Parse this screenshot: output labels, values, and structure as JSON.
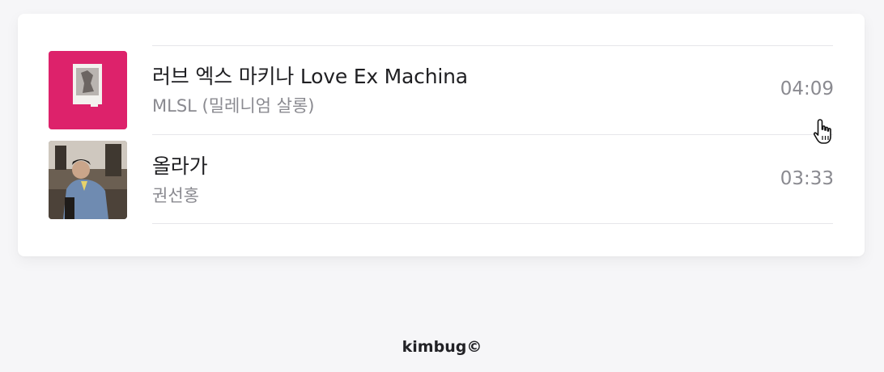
{
  "playlist": {
    "tracks": [
      {
        "title": "러브 엑스 마키나 Love Ex Machina",
        "artist": "MLSL (밀레니엄 살롱)",
        "duration": "04:09",
        "cover_color": "#e0246e"
      },
      {
        "title": "올라가",
        "artist": "권선홍",
        "duration": "03:33",
        "cover_color": "#5a5046"
      }
    ]
  },
  "footer": {
    "credit": "kimbug©"
  },
  "colors": {
    "background": "#f6f6f8",
    "card": "#ffffff",
    "divider": "#e6e6ea",
    "title_text": "#1f1f22",
    "secondary_text": "#8a8a90"
  }
}
